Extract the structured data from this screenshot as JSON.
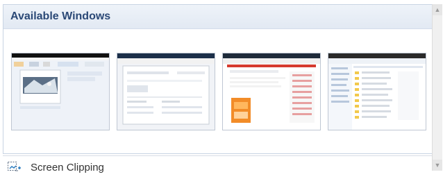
{
  "panel": {
    "title": "Available Windows",
    "clip_label": "Screen Clipping"
  },
  "thumbnails": [
    {
      "name": "window-thumbnail-1"
    },
    {
      "name": "window-thumbnail-2"
    },
    {
      "name": "window-thumbnail-3"
    },
    {
      "name": "window-thumbnail-4"
    }
  ],
  "icons": {
    "scroll_up": "chevron-up-icon",
    "scroll_down": "chevron-down-icon",
    "screen_clipping": "screen-clipping-icon"
  }
}
